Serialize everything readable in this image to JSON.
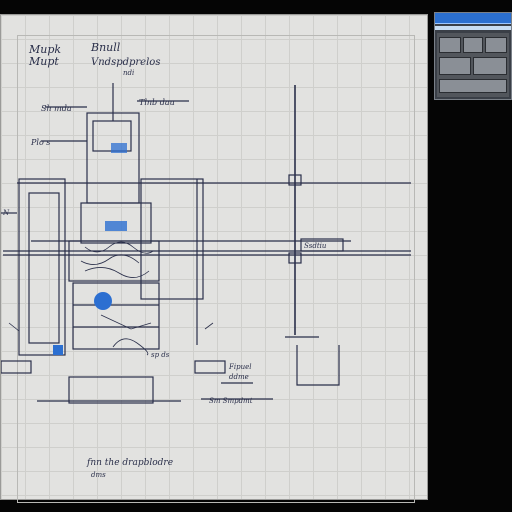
{
  "notes": {
    "top_left_1": "Mupk",
    "top_left_2": "Mupt",
    "top_center_1": "Bnull",
    "top_center_2": "Vndspdprelos",
    "top_center_small": "ndi",
    "mid_label_1": "Tlnb dau",
    "left_label_1": "Sh mda",
    "left_label_2": "Plo s",
    "left_edge": "N",
    "right_box": "Ssdtiu",
    "bottom_mid_1": "sp ds",
    "right_small_1": "Fipuel",
    "right_small_2": "ddme",
    "right_small_3": "Sm Smpdmt",
    "bottom_caption": "fnn the drapblodre",
    "bottom_small": "dms"
  },
  "colors": {
    "paper": "#e2e2e0",
    "grid": "#cfcfcc",
    "ink": "#2a2f4a",
    "accent": "#2c6fd1"
  }
}
